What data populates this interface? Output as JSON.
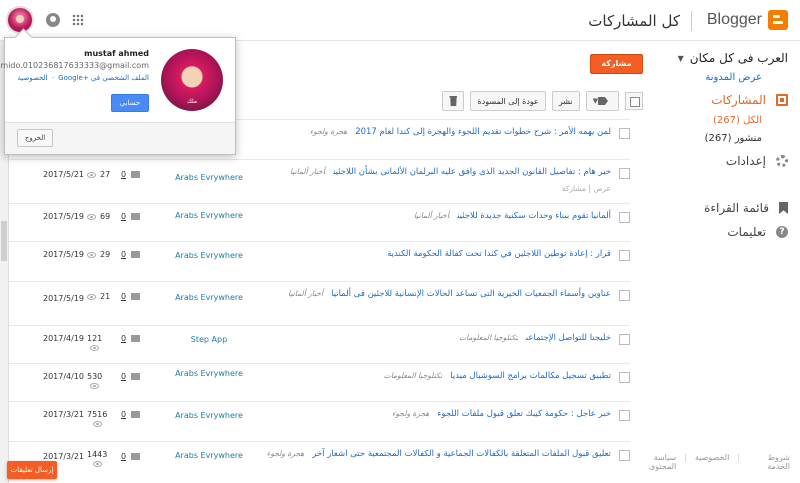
{
  "header": {
    "brand": "Blogger",
    "page_title": "كل المشاركات"
  },
  "sidebar": {
    "blog_name": "العرب فى كل مكان",
    "view_blog": "عرض المدونة",
    "posts": "المشاركات",
    "all_count": "الكل (267)",
    "published_count": "منشور (267)",
    "settings": "إعدادات",
    "reading_list": "قائمة القراءة",
    "help": "تعليمات",
    "footer": [
      "شروط الخدمة",
      "الخصوصية",
      "سياسة المحتوى"
    ]
  },
  "toolbar": {
    "new_post": "مشاركة جديدة",
    "publish": "نشر",
    "revert_to_draft": "عودة إلى المسودة"
  },
  "account": {
    "name": "mustaf ahmed",
    "email": "mido.010236817633333@gmail.com",
    "profile_link": "الملف الشخصي في +Google",
    "privacy_link": "الخصوصية",
    "account_button": "حسابي",
    "sign_out": "الخروج",
    "avatar_caption": "ملك"
  },
  "feedback": "إرسال تعليقات",
  "posts": [
    {
      "title": "لمن يهمه الأمر : شرح خطوات تقديم اللجوء والهجرة إلى كندا لعام 2017",
      "labels": "هجرة ولجوء",
      "author": "",
      "comments": "",
      "views": "",
      "date": "",
      "actions": ""
    },
    {
      "title": "خبر هام : تفاصيل القانون الجديد الذى وافق عليه البرلمان الألمانى بشأن اللاجئين",
      "labels": "أخبار ألمانيا",
      "author": "Arabs Evrywhere",
      "comments": "0",
      "views": "27",
      "date": "2017/5/21",
      "actions": "عرض | مشاركة"
    },
    {
      "title": "ألمانيا تقوم ببناء وحدات سكنية جديدة للاجئين",
      "labels": "أخبار ألمانيا",
      "author": "Arabs Evrywhere",
      "comments": "0",
      "views": "69",
      "date": "2017/5/19",
      "actions": ""
    },
    {
      "title": "قرار : إعادة توطين اللاجئين في كندا تحت كفالة الحكومة الكندية",
      "labels": "",
      "author": "Arabs Evrywhere",
      "comments": "0",
      "views": "29",
      "date": "2017/5/19",
      "actions": ""
    },
    {
      "title": "عناوين وأسماء الجمعيات الخيرية التى تساعد الحالات الإنسانية للاجئين فى ألمانيا",
      "labels": "أخبار ألمانيا",
      "author": "Arabs Evrywhere",
      "comments": "0",
      "views": "21",
      "date": "2017/5/19",
      "actions": ""
    },
    {
      "title": "خليجنا للتواصل الإجتماعى",
      "labels": "تكنلوجيا المعلومات",
      "author": "Step App",
      "comments": "0",
      "views": "121",
      "date": "2017/4/19",
      "actions": ""
    },
    {
      "title": "تطبيق تسجيل مكالمات برامج السوشيال ميديا",
      "labels": "تكنلوجيا المعلومات",
      "author": "Arabs Evrywhere",
      "comments": "0",
      "views": "530",
      "date": "2017/4/10",
      "actions": ""
    },
    {
      "title": "خبر عاجل : حكومة كيبك تعلق قبول ملفات اللجوء",
      "labels": "هجرة ولجوء",
      "author": "Arabs Evrywhere",
      "comments": "0",
      "views": "7516",
      "date": "2017/3/21",
      "actions": ""
    },
    {
      "title": "تعليق قبول الملفات المتعلقة بالكفالات الجماعية و الكفالات المجتمعية حتى اشعار آخر",
      "labels": "هجرة ولجوء",
      "author": "Arabs Evrywhere",
      "comments": "0",
      "views": "1443",
      "date": "2017/3/21",
      "actions": ""
    }
  ]
}
